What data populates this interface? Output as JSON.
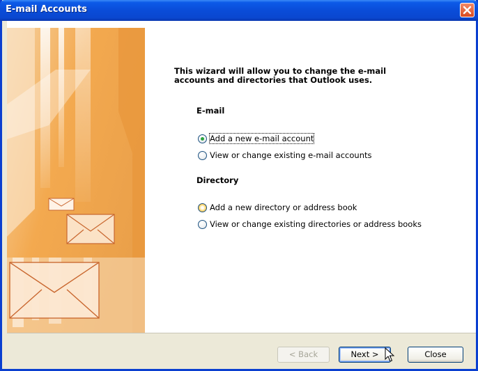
{
  "window": {
    "title": "E-mail Accounts"
  },
  "intro": {
    "line1": "This wizard will allow you to change the e-mail",
    "line2": "accounts and directories that Outlook uses."
  },
  "email_group": {
    "title": "E-mail",
    "options": [
      {
        "label": "Add a new e-mail account",
        "selected": true
      },
      {
        "label": "View or change existing e-mail accounts",
        "selected": false
      }
    ]
  },
  "directory_group": {
    "title": "Directory",
    "options": [
      {
        "label": "Add a new directory or address book",
        "selected": false
      },
      {
        "label": "View or change existing directories or address books",
        "selected": false
      }
    ]
  },
  "buttons": {
    "back": "< Back",
    "next": "Next >",
    "close": "Close"
  },
  "colors": {
    "titlebar": "#0a4cd8",
    "close_button": "#d94a1f",
    "art_orange": "#f0a24a"
  }
}
